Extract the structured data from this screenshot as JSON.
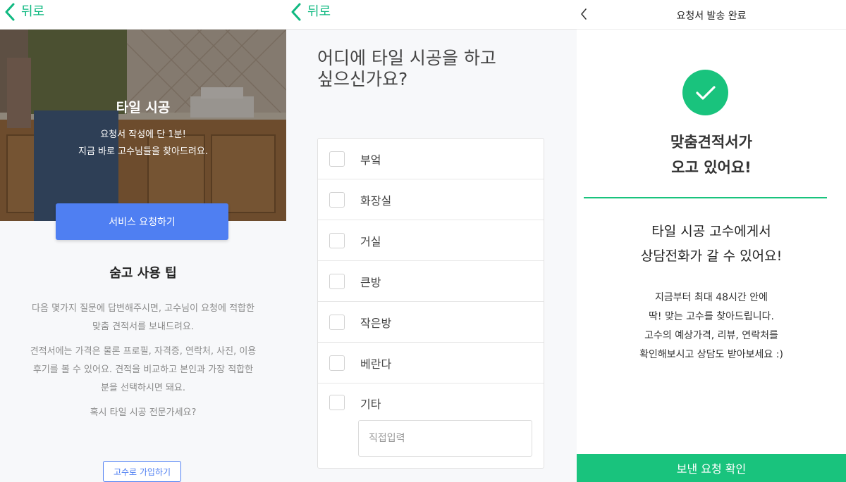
{
  "colors": {
    "accent_green": "#19c37d",
    "back_green": "#10b981",
    "primary_blue": "#4f7ff2"
  },
  "panel1": {
    "back_label": "뒤로",
    "hero_title": "타일 시공",
    "hero_sub_line1": "요청서 작성에 단 1분!",
    "hero_sub_line2": "지금 바로 고수님들을 찾아드려요.",
    "cta_label": "서비스 요청하기",
    "tips_title": "숨고 사용 팁",
    "tips_p1_line1": "다음 몇가지 질문에 답변해주시면, 고수님이 요청에 적합한",
    "tips_p1_line2": "맞춤 견적서를 보내드려요.",
    "tips_p2_line1": "견적서에는 가격은 물론 프로필, 자격증, 연락처, 사진, 이용",
    "tips_p2_line2": "후기를 볼 수 있어요. 견적을 비교하고 본인과 가장 적합한",
    "tips_p2_line3": "분을 선택하시면 돼요.",
    "tips_p3": "혹시 타일 시공 전문가세요?",
    "join_label": "고수로 가입하기"
  },
  "panel2": {
    "back_label": "뒤로",
    "question_line1": "어디에 타일 시공을 하고",
    "question_line2": "싶으신가요?",
    "options": [
      {
        "label": "부엌",
        "checked": false
      },
      {
        "label": "화장실",
        "checked": false
      },
      {
        "label": "거실",
        "checked": false
      },
      {
        "label": "큰방",
        "checked": false
      },
      {
        "label": "작은방",
        "checked": false
      },
      {
        "label": "베란다",
        "checked": false
      },
      {
        "label": "기타",
        "checked": false
      }
    ],
    "other_placeholder": "직접입력"
  },
  "panel3": {
    "header_title": "요청서 발송 완료",
    "done_line1": "맞춤견적서가",
    "done_line2": "오고 있어요!",
    "info_line1": "타일 시공 고수에게서",
    "info_line2": "상담전화가 갈 수 있어요!",
    "desc_line1": "지금부터 최대 48시간 안에",
    "desc_line2": "딱! 맞는 고수를 찾아드립니다.",
    "desc_line3": "고수의 예상가격, 리뷰, 연락처를",
    "desc_line4": "확인해보시고 상담도 받아보세요 :)",
    "confirm_label": "보낸 요청 확인"
  }
}
